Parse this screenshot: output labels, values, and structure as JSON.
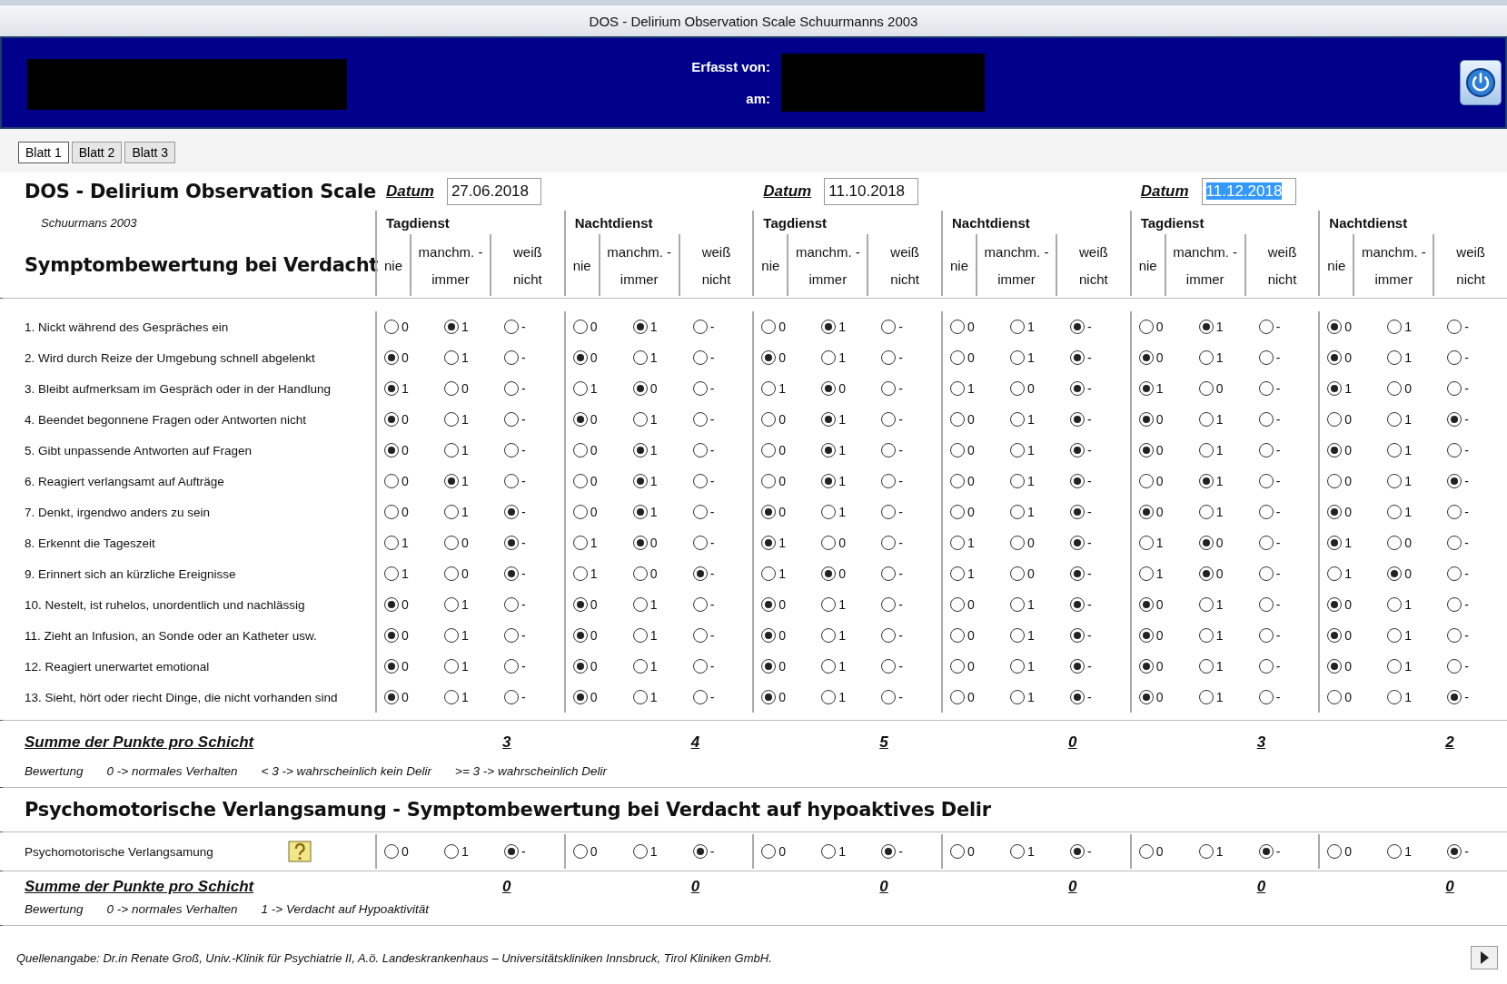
{
  "window": {
    "title": "DOS - Delirium Observation Scale Schuurmanns 2003"
  },
  "banner": {
    "recorded_by_label": "Erfasst von:",
    "date_label": "am:"
  },
  "tabs": [
    {
      "label": "Blatt 1",
      "selected": true
    },
    {
      "label": "Blatt 2",
      "selected": false
    },
    {
      "label": "Blatt 3",
      "selected": false
    }
  ],
  "form": {
    "title": "DOS - Delirium Observation Scale",
    "subtitle": "Schuurmans 2003",
    "section": "Symptombewertung bei Verdacht"
  },
  "dates": [
    {
      "label": "Datum",
      "value": "27.06.2018",
      "highlighted": false
    },
    {
      "label": "Datum",
      "value": "11.10.2018",
      "highlighted": false
    },
    {
      "label": "Datum",
      "value": "11.12.2018",
      "highlighted": true
    }
  ],
  "shifts": [
    {
      "name": "Tagdienst",
      "columns": [
        [
          "nie"
        ],
        [
          "manchm. -",
          "immer"
        ],
        [
          "weiß",
          "nicht"
        ]
      ]
    },
    {
      "name": "Nachtdienst",
      "columns": [
        [
          "nie"
        ],
        [
          "manchm. -",
          "immer"
        ],
        [
          "weiß",
          "nicht"
        ]
      ]
    },
    {
      "name": "Tagdienst",
      "columns": [
        [
          "nie"
        ],
        [
          "manchm. -",
          "immer"
        ],
        [
          "weiß",
          "nicht"
        ]
      ]
    },
    {
      "name": "Nachtdienst",
      "columns": [
        [
          "nie"
        ],
        [
          "manchm. -",
          "immer"
        ],
        [
          "weiß",
          "nicht"
        ]
      ]
    },
    {
      "name": "Tagdienst",
      "columns": [
        [
          "nie"
        ],
        [
          "manchm. -",
          "immer"
        ],
        [
          "weiß",
          "nicht"
        ]
      ]
    },
    {
      "name": "Nachtdienst",
      "columns": [
        [
          "nie"
        ],
        [
          "manchm. -",
          "immer"
        ],
        [
          "weiß",
          "nicht"
        ]
      ]
    }
  ],
  "items": [
    {
      "text": "1. Nickt während des Gespräches ein",
      "answers": [
        [
          {
            "label": "0",
            "selected": false
          },
          {
            "label": "1",
            "selected": true
          },
          {
            "label": "-",
            "selected": false
          }
        ],
        [
          {
            "label": "0",
            "selected": false
          },
          {
            "label": "1",
            "selected": true
          },
          {
            "label": "-",
            "selected": false
          }
        ],
        [
          {
            "label": "0",
            "selected": false
          },
          {
            "label": "1",
            "selected": true
          },
          {
            "label": "-",
            "selected": false
          }
        ],
        [
          {
            "label": "0",
            "selected": false
          },
          {
            "label": "1",
            "selected": false
          },
          {
            "label": "-",
            "selected": true
          }
        ],
        [
          {
            "label": "0",
            "selected": false
          },
          {
            "label": "1",
            "selected": true
          },
          {
            "label": "-",
            "selected": false
          }
        ],
        [
          {
            "label": "0",
            "selected": true
          },
          {
            "label": "1",
            "selected": false
          },
          {
            "label": "-",
            "selected": false
          }
        ]
      ]
    },
    {
      "text": "2. Wird durch Reize der Umgebung schnell abgelenkt",
      "answers": [
        [
          {
            "label": "0",
            "selected": true
          },
          {
            "label": "1",
            "selected": false
          },
          {
            "label": "-",
            "selected": false
          }
        ],
        [
          {
            "label": "0",
            "selected": true
          },
          {
            "label": "1",
            "selected": false
          },
          {
            "label": "-",
            "selected": false
          }
        ],
        [
          {
            "label": "0",
            "selected": true
          },
          {
            "label": "1",
            "selected": false
          },
          {
            "label": "-",
            "selected": false
          }
        ],
        [
          {
            "label": "0",
            "selected": false
          },
          {
            "label": "1",
            "selected": false
          },
          {
            "label": "-",
            "selected": true
          }
        ],
        [
          {
            "label": "0",
            "selected": true
          },
          {
            "label": "1",
            "selected": false
          },
          {
            "label": "-",
            "selected": false
          }
        ],
        [
          {
            "label": "0",
            "selected": true
          },
          {
            "label": "1",
            "selected": false
          },
          {
            "label": "-",
            "selected": false
          }
        ]
      ]
    },
    {
      "text": "3. Bleibt aufmerksam im Gespräch oder in der Handlung",
      "answers": [
        [
          {
            "label": "1",
            "selected": true
          },
          {
            "label": "0",
            "selected": false
          },
          {
            "label": "-",
            "selected": false
          }
        ],
        [
          {
            "label": "1",
            "selected": false
          },
          {
            "label": "0",
            "selected": true
          },
          {
            "label": "-",
            "selected": false
          }
        ],
        [
          {
            "label": "1",
            "selected": false
          },
          {
            "label": "0",
            "selected": true
          },
          {
            "label": "-",
            "selected": false
          }
        ],
        [
          {
            "label": "1",
            "selected": false
          },
          {
            "label": "0",
            "selected": false
          },
          {
            "label": "-",
            "selected": true
          }
        ],
        [
          {
            "label": "1",
            "selected": true
          },
          {
            "label": "0",
            "selected": false
          },
          {
            "label": "-",
            "selected": false
          }
        ],
        [
          {
            "label": "1",
            "selected": true
          },
          {
            "label": "0",
            "selected": false
          },
          {
            "label": "-",
            "selected": false
          }
        ]
      ]
    },
    {
      "text": "4. Beendet begonnene Fragen oder Antworten nicht",
      "answers": [
        [
          {
            "label": "0",
            "selected": true
          },
          {
            "label": "1",
            "selected": false
          },
          {
            "label": "-",
            "selected": false
          }
        ],
        [
          {
            "label": "0",
            "selected": true
          },
          {
            "label": "1",
            "selected": false
          },
          {
            "label": "-",
            "selected": false
          }
        ],
        [
          {
            "label": "0",
            "selected": false
          },
          {
            "label": "1",
            "selected": true
          },
          {
            "label": "-",
            "selected": false
          }
        ],
        [
          {
            "label": "0",
            "selected": false
          },
          {
            "label": "1",
            "selected": false
          },
          {
            "label": "-",
            "selected": true
          }
        ],
        [
          {
            "label": "0",
            "selected": true
          },
          {
            "label": "1",
            "selected": false
          },
          {
            "label": "-",
            "selected": false
          }
        ],
        [
          {
            "label": "0",
            "selected": false
          },
          {
            "label": "1",
            "selected": false
          },
          {
            "label": "-",
            "selected": true
          }
        ]
      ]
    },
    {
      "text": "5. Gibt unpassende Antworten auf Fragen",
      "answers": [
        [
          {
            "label": "0",
            "selected": true
          },
          {
            "label": "1",
            "selected": false
          },
          {
            "label": "-",
            "selected": false
          }
        ],
        [
          {
            "label": "0",
            "selected": false
          },
          {
            "label": "1",
            "selected": true
          },
          {
            "label": "-",
            "selected": false
          }
        ],
        [
          {
            "label": "0",
            "selected": false
          },
          {
            "label": "1",
            "selected": true
          },
          {
            "label": "-",
            "selected": false
          }
        ],
        [
          {
            "label": "0",
            "selected": false
          },
          {
            "label": "1",
            "selected": false
          },
          {
            "label": "-",
            "selected": true
          }
        ],
        [
          {
            "label": "0",
            "selected": true
          },
          {
            "label": "1",
            "selected": false
          },
          {
            "label": "-",
            "selected": false
          }
        ],
        [
          {
            "label": "0",
            "selected": true
          },
          {
            "label": "1",
            "selected": false
          },
          {
            "label": "-",
            "selected": false
          }
        ]
      ]
    },
    {
      "text": "6. Reagiert verlangsamt auf Aufträge",
      "answers": [
        [
          {
            "label": "0",
            "selected": false
          },
          {
            "label": "1",
            "selected": true
          },
          {
            "label": "-",
            "selected": false
          }
        ],
        [
          {
            "label": "0",
            "selected": false
          },
          {
            "label": "1",
            "selected": true
          },
          {
            "label": "-",
            "selected": false
          }
        ],
        [
          {
            "label": "0",
            "selected": false
          },
          {
            "label": "1",
            "selected": true
          },
          {
            "label": "-",
            "selected": false
          }
        ],
        [
          {
            "label": "0",
            "selected": false
          },
          {
            "label": "1",
            "selected": false
          },
          {
            "label": "-",
            "selected": true
          }
        ],
        [
          {
            "label": "0",
            "selected": false
          },
          {
            "label": "1",
            "selected": true
          },
          {
            "label": "-",
            "selected": false
          }
        ],
        [
          {
            "label": "0",
            "selected": false
          },
          {
            "label": "1",
            "selected": false
          },
          {
            "label": "-",
            "selected": true
          }
        ]
      ]
    },
    {
      "text": "7. Denkt, irgendwo anders zu sein",
      "answers": [
        [
          {
            "label": "0",
            "selected": false
          },
          {
            "label": "1",
            "selected": false
          },
          {
            "label": "-",
            "selected": true
          }
        ],
        [
          {
            "label": "0",
            "selected": false
          },
          {
            "label": "1",
            "selected": true
          },
          {
            "label": "-",
            "selected": false
          }
        ],
        [
          {
            "label": "0",
            "selected": true
          },
          {
            "label": "1",
            "selected": false
          },
          {
            "label": "-",
            "selected": false
          }
        ],
        [
          {
            "label": "0",
            "selected": false
          },
          {
            "label": "1",
            "selected": false
          },
          {
            "label": "-",
            "selected": true
          }
        ],
        [
          {
            "label": "0",
            "selected": true
          },
          {
            "label": "1",
            "selected": false
          },
          {
            "label": "-",
            "selected": false
          }
        ],
        [
          {
            "label": "0",
            "selected": true
          },
          {
            "label": "1",
            "selected": false
          },
          {
            "label": "-",
            "selected": false
          }
        ]
      ]
    },
    {
      "text": "8. Erkennt die Tageszeit",
      "answers": [
        [
          {
            "label": "1",
            "selected": false
          },
          {
            "label": "0",
            "selected": false
          },
          {
            "label": "-",
            "selected": true
          }
        ],
        [
          {
            "label": "1",
            "selected": false
          },
          {
            "label": "0",
            "selected": true
          },
          {
            "label": "-",
            "selected": false
          }
        ],
        [
          {
            "label": "1",
            "selected": true
          },
          {
            "label": "0",
            "selected": false
          },
          {
            "label": "-",
            "selected": false
          }
        ],
        [
          {
            "label": "1",
            "selected": false
          },
          {
            "label": "0",
            "selected": false
          },
          {
            "label": "-",
            "selected": true
          }
        ],
        [
          {
            "label": "1",
            "selected": false
          },
          {
            "label": "0",
            "selected": true
          },
          {
            "label": "-",
            "selected": false
          }
        ],
        [
          {
            "label": "1",
            "selected": true
          },
          {
            "label": "0",
            "selected": false
          },
          {
            "label": "-",
            "selected": false
          }
        ]
      ]
    },
    {
      "text": "9. Erinnert sich an kürzliche Ereignisse",
      "answers": [
        [
          {
            "label": "1",
            "selected": false
          },
          {
            "label": "0",
            "selected": false
          },
          {
            "label": "-",
            "selected": true
          }
        ],
        [
          {
            "label": "1",
            "selected": false
          },
          {
            "label": "0",
            "selected": false
          },
          {
            "label": "-",
            "selected": true
          }
        ],
        [
          {
            "label": "1",
            "selected": false
          },
          {
            "label": "0",
            "selected": true
          },
          {
            "label": "-",
            "selected": false
          }
        ],
        [
          {
            "label": "1",
            "selected": false
          },
          {
            "label": "0",
            "selected": false
          },
          {
            "label": "-",
            "selected": true
          }
        ],
        [
          {
            "label": "1",
            "selected": false
          },
          {
            "label": "0",
            "selected": true
          },
          {
            "label": "-",
            "selected": false
          }
        ],
        [
          {
            "label": "1",
            "selected": false
          },
          {
            "label": "0",
            "selected": true
          },
          {
            "label": "-",
            "selected": false
          }
        ]
      ]
    },
    {
      "text": "10. Nestelt, ist ruhelos, unordentlich und nachlässig",
      "answers": [
        [
          {
            "label": "0",
            "selected": true
          },
          {
            "label": "1",
            "selected": false
          },
          {
            "label": "-",
            "selected": false
          }
        ],
        [
          {
            "label": "0",
            "selected": true
          },
          {
            "label": "1",
            "selected": false
          },
          {
            "label": "-",
            "selected": false
          }
        ],
        [
          {
            "label": "0",
            "selected": true
          },
          {
            "label": "1",
            "selected": false
          },
          {
            "label": "-",
            "selected": false
          }
        ],
        [
          {
            "label": "0",
            "selected": false
          },
          {
            "label": "1",
            "selected": false
          },
          {
            "label": "-",
            "selected": true
          }
        ],
        [
          {
            "label": "0",
            "selected": true
          },
          {
            "label": "1",
            "selected": false
          },
          {
            "label": "-",
            "selected": false
          }
        ],
        [
          {
            "label": "0",
            "selected": true
          },
          {
            "label": "1",
            "selected": false
          },
          {
            "label": "-",
            "selected": false
          }
        ]
      ]
    },
    {
      "text": "11. Zieht an Infusion, an Sonde oder an Katheter usw.",
      "answers": [
        [
          {
            "label": "0",
            "selected": true
          },
          {
            "label": "1",
            "selected": false
          },
          {
            "label": "-",
            "selected": false
          }
        ],
        [
          {
            "label": "0",
            "selected": true
          },
          {
            "label": "1",
            "selected": false
          },
          {
            "label": "-",
            "selected": false
          }
        ],
        [
          {
            "label": "0",
            "selected": true
          },
          {
            "label": "1",
            "selected": false
          },
          {
            "label": "-",
            "selected": false
          }
        ],
        [
          {
            "label": "0",
            "selected": false
          },
          {
            "label": "1",
            "selected": false
          },
          {
            "label": "-",
            "selected": true
          }
        ],
        [
          {
            "label": "0",
            "selected": true
          },
          {
            "label": "1",
            "selected": false
          },
          {
            "label": "-",
            "selected": false
          }
        ],
        [
          {
            "label": "0",
            "selected": true
          },
          {
            "label": "1",
            "selected": false
          },
          {
            "label": "-",
            "selected": false
          }
        ]
      ]
    },
    {
      "text": "12. Reagiert unerwartet emotional",
      "answers": [
        [
          {
            "label": "0",
            "selected": true
          },
          {
            "label": "1",
            "selected": false
          },
          {
            "label": "-",
            "selected": false
          }
        ],
        [
          {
            "label": "0",
            "selected": true
          },
          {
            "label": "1",
            "selected": false
          },
          {
            "label": "-",
            "selected": false
          }
        ],
        [
          {
            "label": "0",
            "selected": true
          },
          {
            "label": "1",
            "selected": false
          },
          {
            "label": "-",
            "selected": false
          }
        ],
        [
          {
            "label": "0",
            "selected": false
          },
          {
            "label": "1",
            "selected": false
          },
          {
            "label": "-",
            "selected": true
          }
        ],
        [
          {
            "label": "0",
            "selected": true
          },
          {
            "label": "1",
            "selected": false
          },
          {
            "label": "-",
            "selected": false
          }
        ],
        [
          {
            "label": "0",
            "selected": true
          },
          {
            "label": "1",
            "selected": false
          },
          {
            "label": "-",
            "selected": false
          }
        ]
      ]
    },
    {
      "text": "13. Sieht, hört oder riecht Dinge, die nicht vorhanden sind",
      "answers": [
        [
          {
            "label": "0",
            "selected": true
          },
          {
            "label": "1",
            "selected": false
          },
          {
            "label": "-",
            "selected": false
          }
        ],
        [
          {
            "label": "0",
            "selected": true
          },
          {
            "label": "1",
            "selected": false
          },
          {
            "label": "-",
            "selected": false
          }
        ],
        [
          {
            "label": "0",
            "selected": true
          },
          {
            "label": "1",
            "selected": false
          },
          {
            "label": "-",
            "selected": false
          }
        ],
        [
          {
            "label": "0",
            "selected": false
          },
          {
            "label": "1",
            "selected": false
          },
          {
            "label": "-",
            "selected": true
          }
        ],
        [
          {
            "label": "0",
            "selected": true
          },
          {
            "label": "1",
            "selected": false
          },
          {
            "label": "-",
            "selected": false
          }
        ],
        [
          {
            "label": "0",
            "selected": false
          },
          {
            "label": "1",
            "selected": false
          },
          {
            "label": "-",
            "selected": true
          }
        ]
      ]
    }
  ],
  "sum": {
    "label": "Summe der Punkte pro Schicht",
    "values": [
      "3",
      "4",
      "5",
      "0",
      "3",
      "2"
    ]
  },
  "legend": {
    "label": "Bewertung",
    "entries": [
      "0 -> normales Verhalten",
      "< 3 -> wahrscheinlich kein Delir",
      ">= 3 -> wahrscheinlich Delir"
    ]
  },
  "psycho": {
    "title": "Psychomotorische Verlangsamung - Symptombewertung bei Verdacht auf hypoaktives Delir",
    "item": {
      "text": "Psychomotorische Verlangsamung",
      "answers": [
        [
          {
            "label": "0",
            "selected": false
          },
          {
            "label": "1",
            "selected": false
          },
          {
            "label": "-",
            "selected": true
          }
        ],
        [
          {
            "label": "0",
            "selected": false
          },
          {
            "label": "1",
            "selected": false
          },
          {
            "label": "-",
            "selected": true
          }
        ],
        [
          {
            "label": "0",
            "selected": false
          },
          {
            "label": "1",
            "selected": false
          },
          {
            "label": "-",
            "selected": true
          }
        ],
        [
          {
            "label": "0",
            "selected": false
          },
          {
            "label": "1",
            "selected": false
          },
          {
            "label": "-",
            "selected": true
          }
        ],
        [
          {
            "label": "0",
            "selected": false
          },
          {
            "label": "1",
            "selected": false
          },
          {
            "label": "-",
            "selected": true
          }
        ],
        [
          {
            "label": "0",
            "selected": false
          },
          {
            "label": "1",
            "selected": false
          },
          {
            "label": "-",
            "selected": true
          }
        ]
      ]
    },
    "sum": {
      "label": "Summe der Punkte pro Schicht",
      "values": [
        "0",
        "0",
        "0",
        "0",
        "0",
        "0"
      ]
    },
    "legend": {
      "label": "Bewertung",
      "entries": [
        "0 -> normales Verhalten",
        "1 -> Verdacht auf Hypoaktivität"
      ]
    }
  },
  "footer": {
    "source": "Quellenangabe: Dr.in Renate Groß, Univ.-Klinik für Psychiatrie II, A.ö. Landeskrankenhaus – Universitätskliniken Innsbruck, Tirol Kliniken GmbH."
  }
}
